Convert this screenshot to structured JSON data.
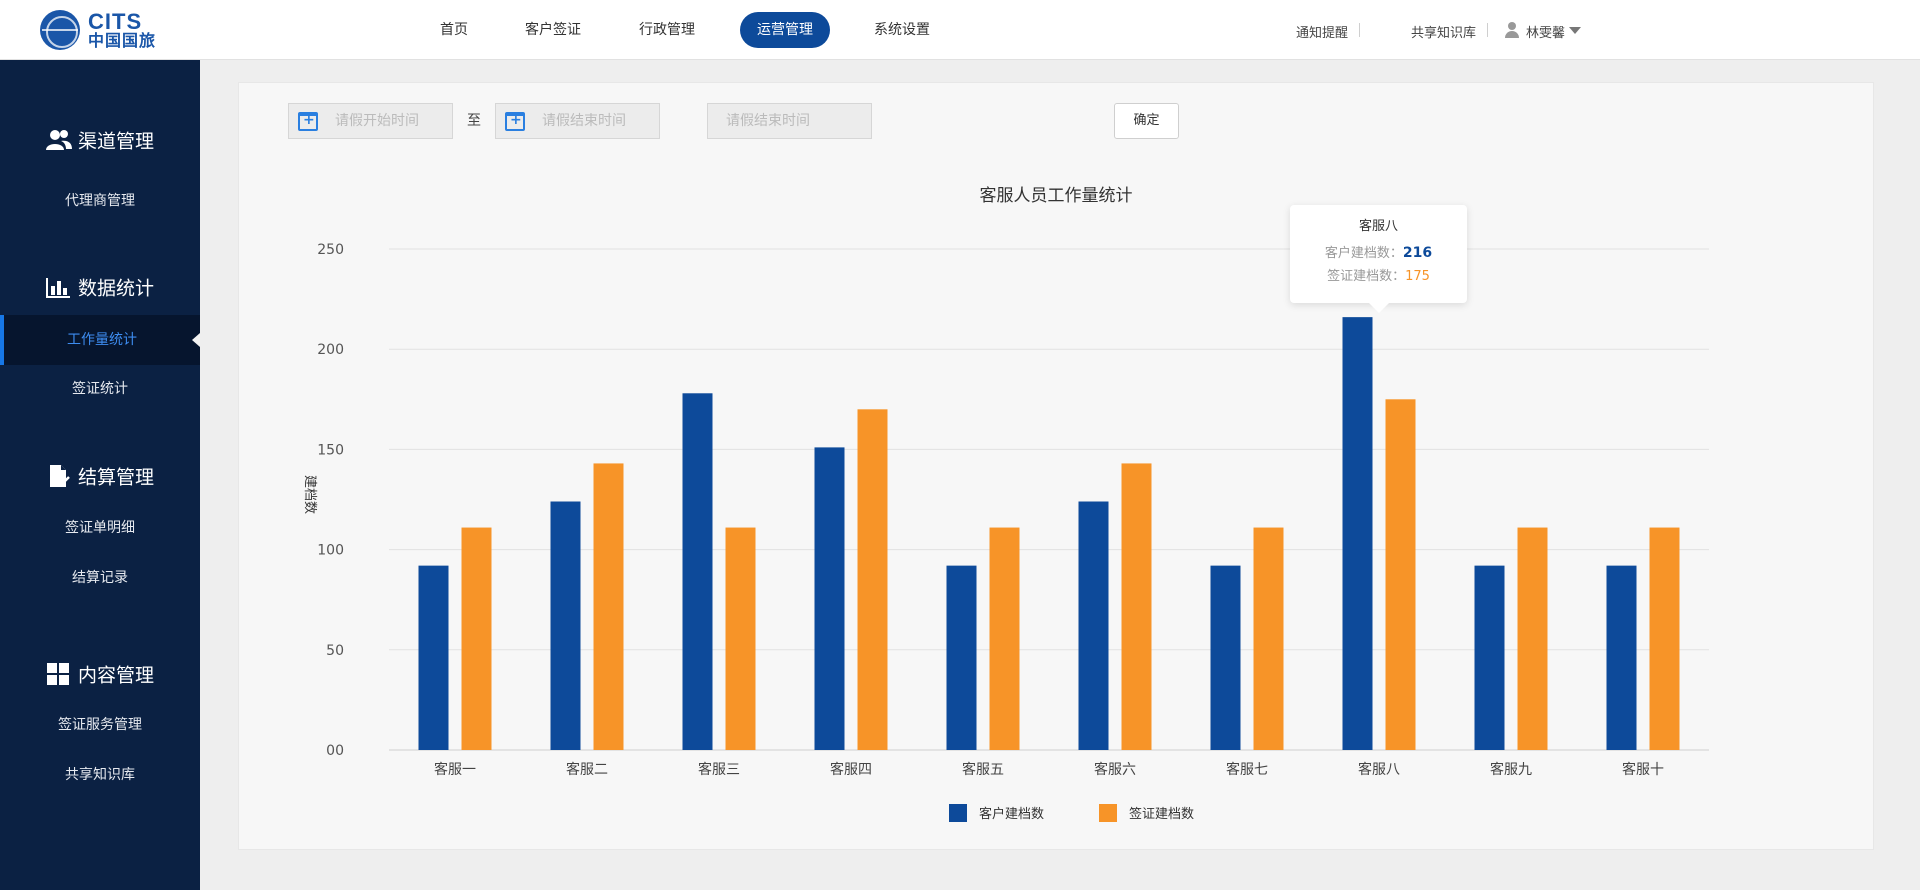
{
  "logo": {
    "en": "CITS",
    "cn": "中国国旅"
  },
  "nav": [
    {
      "label": "首页",
      "active": false
    },
    {
      "label": "客户签证",
      "active": false
    },
    {
      "label": "行政管理",
      "active": false
    },
    {
      "label": "运营管理",
      "active": true
    },
    {
      "label": "系统设置",
      "active": false
    }
  ],
  "top_right": {
    "notify": "通知提醒",
    "knowledge": "共享知识库",
    "user": "林雯馨"
  },
  "sidebar": {
    "sections": [
      {
        "title": "渠道管理",
        "icon": "users-icon",
        "items": [
          "代理商管理"
        ]
      },
      {
        "title": "数据统计",
        "icon": "bar-chart-icon",
        "items": [
          "工作量统计",
          "签证统计"
        ]
      },
      {
        "title": "结算管理",
        "icon": "document-check-icon",
        "items": [
          "签证单明细",
          "结算记录"
        ]
      },
      {
        "title": "内容管理",
        "icon": "grid-icon",
        "items": [
          "签证服务管理",
          "共享知识库"
        ]
      }
    ],
    "active_item": "工作量统计"
  },
  "filters": {
    "start_placeholder": "请假开始时间",
    "to_label": "至",
    "end_placeholder": "请假结束时间",
    "extra_placeholder": "请假结束时间",
    "confirm_label": "确定"
  },
  "colors": {
    "primary": "#0d4a9a",
    "accent": "#f79428",
    "sidebar": "#0b2143"
  },
  "chart_data": {
    "type": "bar",
    "title": "客服人员工作量统计",
    "ylabel": "建档数",
    "xlabel": "",
    "ylim": [
      0,
      250
    ],
    "yticks": [
      "00",
      "50",
      "100",
      "150",
      "200",
      "250"
    ],
    "categories": [
      "客服一",
      "客服二",
      "客服三",
      "客服四",
      "客服五",
      "客服六",
      "客服七",
      "客服八",
      "客服九",
      "客服十"
    ],
    "series": [
      {
        "name": "客户建档数",
        "color": "#0d4a9a",
        "values": [
          92,
          124,
          178,
          151,
          92,
          124,
          92,
          216,
          92,
          92
        ]
      },
      {
        "name": "签证建档数",
        "color": "#f79428",
        "values": [
          111,
          143,
          111,
          170,
          111,
          143,
          111,
          175,
          111,
          111
        ]
      }
    ],
    "legend_position": "bottom-center",
    "grid": true,
    "tooltip": {
      "category": "客服八",
      "rows": [
        {
          "label": "客户建档数：",
          "value": "216"
        },
        {
          "label": "签证建档数：",
          "value": "175"
        }
      ]
    }
  }
}
